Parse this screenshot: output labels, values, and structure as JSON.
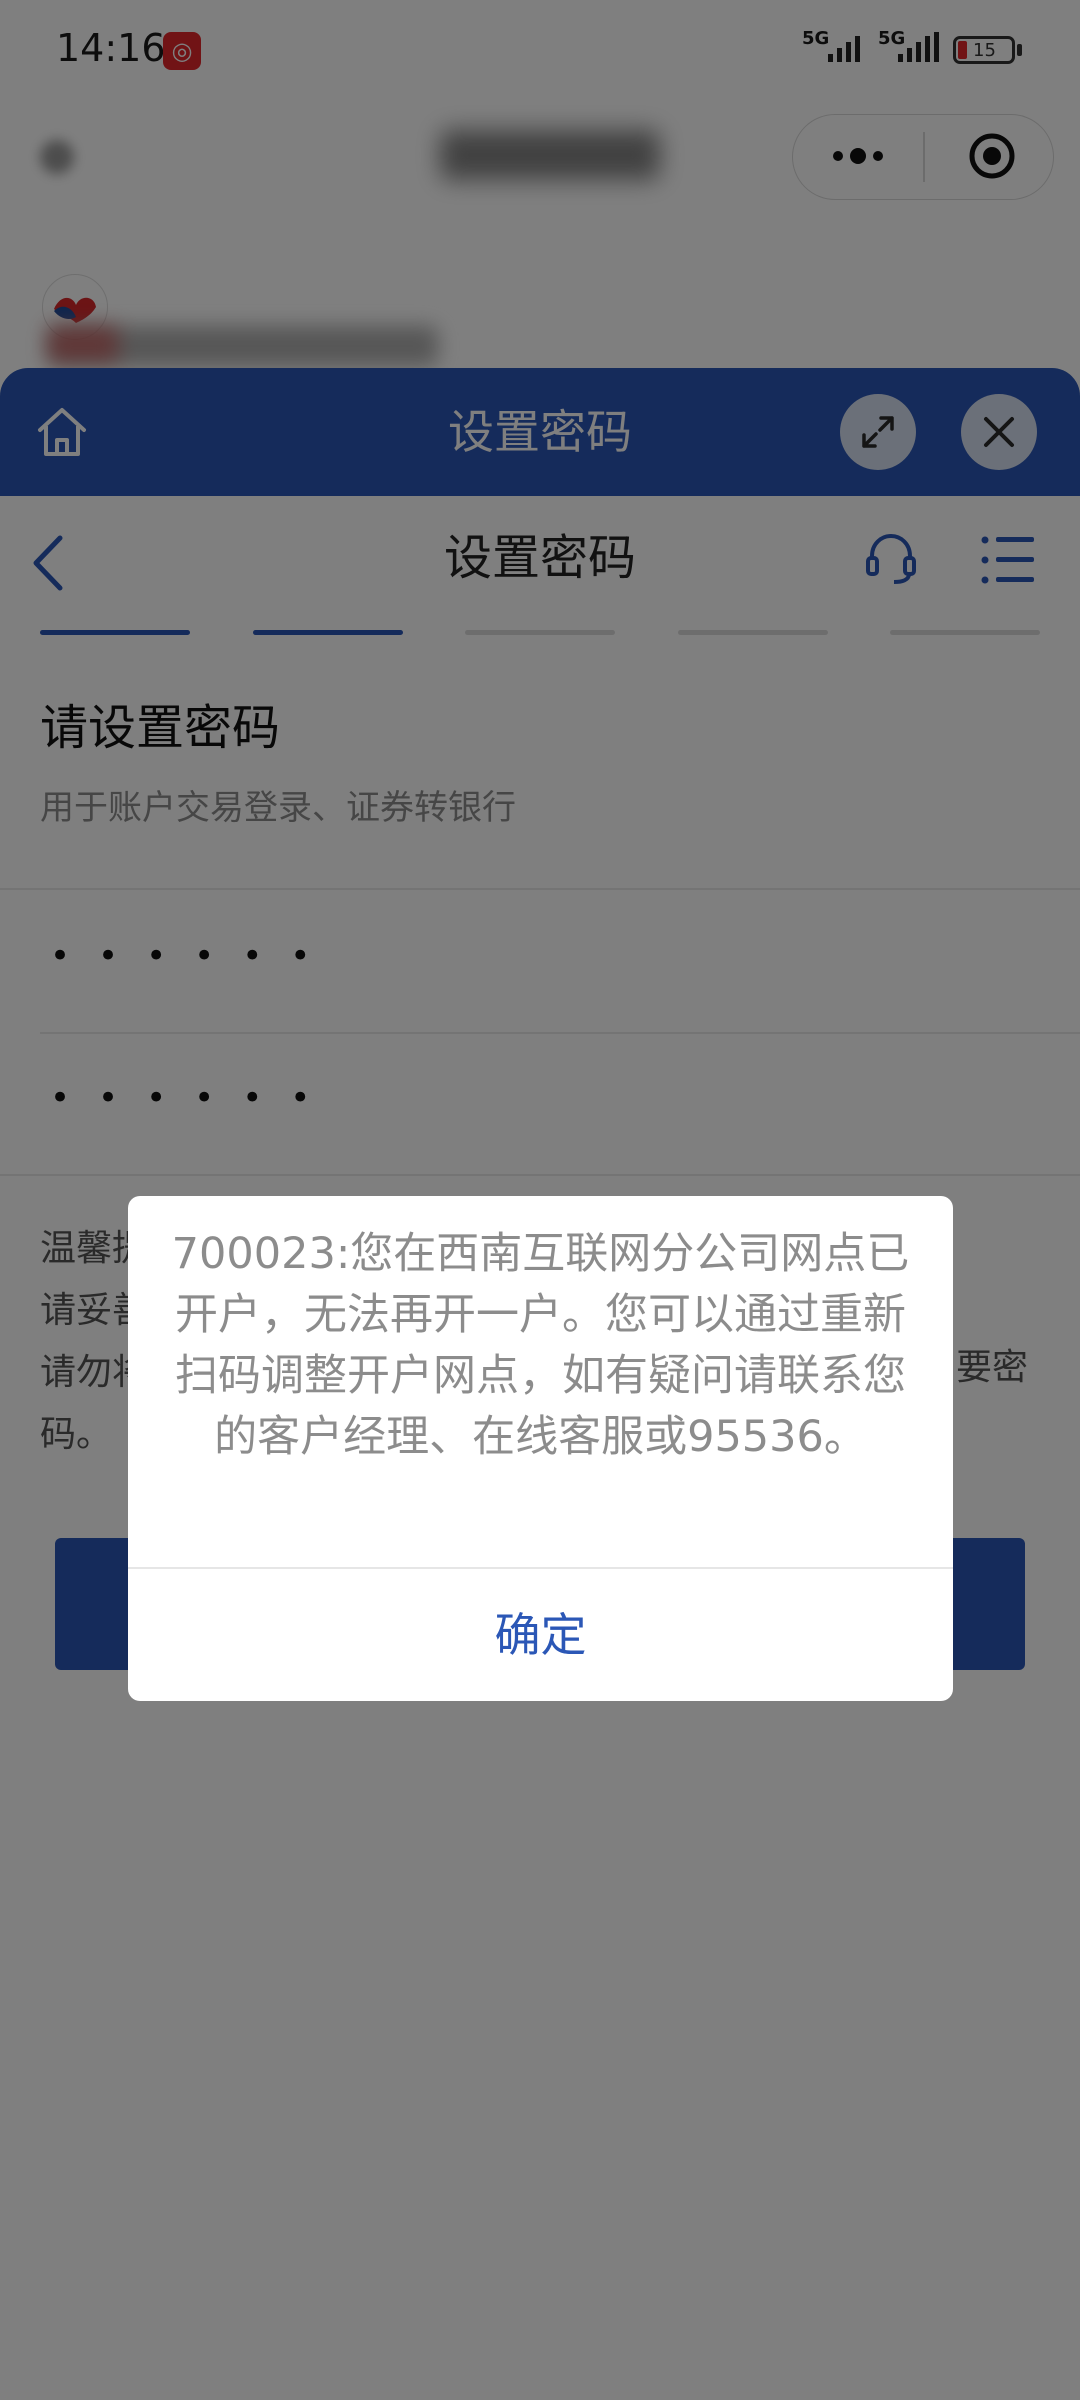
{
  "status_bar": {
    "time": "14:16",
    "network_1": "5G",
    "network_2": "5G",
    "battery": "15"
  },
  "mini_program": {
    "provider_label": "国信VIP服务 提供服务",
    "provider_arrow": "›"
  },
  "sheet": {
    "title": "设置密码"
  },
  "page": {
    "nav_title": "设置密码",
    "steps": [
      true,
      true,
      false,
      false,
      false
    ],
    "heading": "请设置密码",
    "subheading": "用于账户交易登录、证券转银行",
    "password_1": "••••••",
    "password_2": "••••••",
    "tips_line_1": "温馨提",
    "tips_line_2": "请妥善",
    "tips_line_3": "请勿将",
    "tips_line_4": "码。",
    "tips_right": "要密"
  },
  "dialog": {
    "message": "700023:您在西南互联网分公司网点已开户，无法再开一户。您可以通过重新扫码调整开户网点，如有疑问请联系您的客户经理、在线客服或95536。",
    "confirm_label": "确定"
  },
  "colors": {
    "brand_blue": "#2b57b6",
    "overlay": "rgba(0,0,0,0.5)"
  }
}
